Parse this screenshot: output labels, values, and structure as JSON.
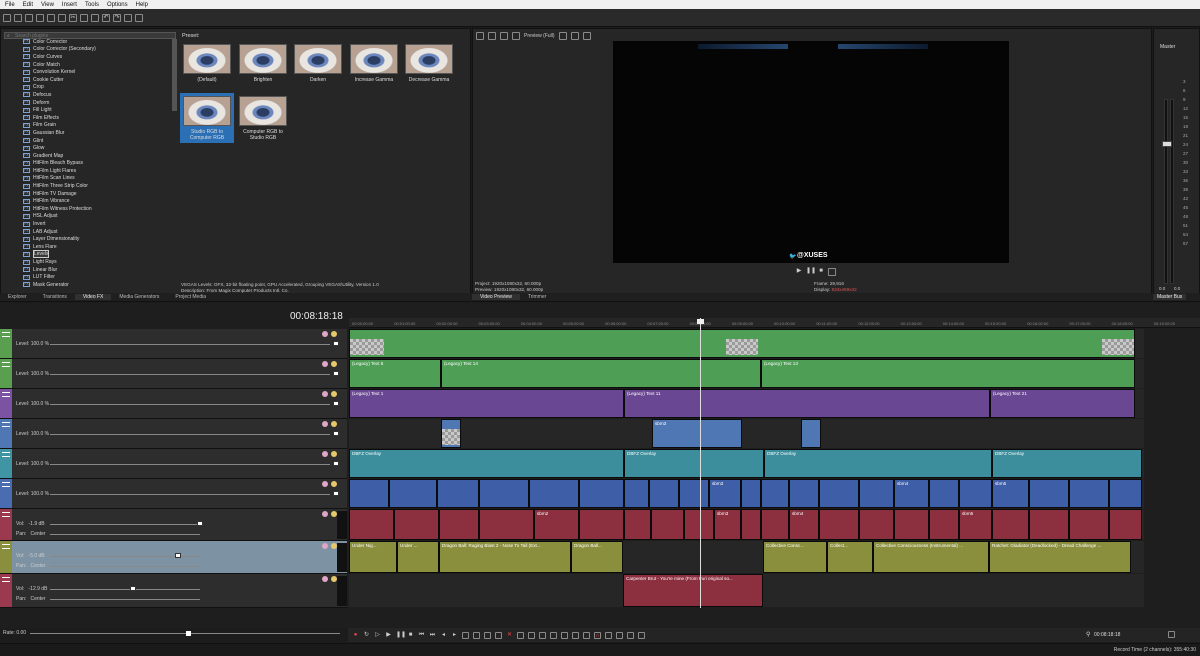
{
  "menu": [
    "File",
    "Edit",
    "View",
    "Insert",
    "Tools",
    "Options",
    "Help"
  ],
  "explorer": {
    "search_placeholder": "Search plugins",
    "preset_label": "Preset:",
    "plugins": [
      "Color Corrector",
      "Color Corrector (Secondary)",
      "Color Curves",
      "Color Match",
      "Convolution Kernel",
      "Cookie Cutter",
      "Crop",
      "Defocus",
      "Deform",
      "Fill Light",
      "Film Effects",
      "Film Grain",
      "Gaussian Blur",
      "Glint",
      "Glow",
      "Gradient Map",
      "HitFilm Bleach Bypass",
      "HitFilm Light Flares",
      "HitFilm Scan Lines",
      "HitFilm Three Strip Color",
      "HitFilm TV Damage",
      "HitFilm Vibrance",
      "HitFilm Witness Protection",
      "HSL Adjust",
      "Invert",
      "LAB Adjust",
      "Layer Dimensionality",
      "Lens Flare",
      "Levels",
      "Light Rays",
      "Linear Blur",
      "LUT Filter",
      "Mask Generator"
    ],
    "selected_plugin": "Levels",
    "presets": [
      {
        "name": "(Default)"
      },
      {
        "name": "Brighten"
      },
      {
        "name": "Darken"
      },
      {
        "name": "Increase Gamma"
      },
      {
        "name": "Decrease Gamma"
      },
      {
        "name": "Studio RGB to Computer RGB",
        "selected": true
      },
      {
        "name": "Computer RGB to Studio RGB"
      }
    ],
    "info_line1": "VEGAS Levels: OFX, 32-bit floating point, GPU Accelerated, Grouping VEGAS\\Utility, Version 1.0",
    "info_line2": "Description: From Magix Computer Products Intl. Co.",
    "tabs": [
      "Explorer",
      "Transitions",
      "Video FX",
      "Media Generators",
      "Project Media"
    ],
    "active_tab": "Video FX"
  },
  "preview": {
    "toolbar_label": "Preview (Full)",
    "overlay_text": "@XUSES",
    "project": "Project:",
    "project_val": "1920x1080x32, 60.000p",
    "preview": "Preview:",
    "preview_val": "1920x1080x32, 60.000p",
    "frame": "Frame:",
    "frame_val": "29,916",
    "display": "Display:",
    "display_val": "834x469x32",
    "tabs": [
      "Video Preview",
      "Trimmer"
    ]
  },
  "master": {
    "label": "Master",
    "scale": [
      "3",
      "6",
      "9",
      "12",
      "15",
      "18",
      "21",
      "24",
      "27",
      "30",
      "33",
      "36",
      "39",
      "42",
      "45",
      "48",
      "51",
      "54",
      "57"
    ],
    "bottom_left": "0.0",
    "bottom_right": "0.0",
    "tab": "Master Bus"
  },
  "timeline": {
    "timecode": "00:08:18:18",
    "ruler": [
      "00:00:00:00",
      "00:01:00:00",
      "00:02:00:00",
      "00:03:00:00",
      "00:04:00:00",
      "00:05:00:00",
      "00:06:00:00",
      "00:07:00:00",
      "00:08:00:00",
      "00:09:00:00",
      "00:10:00:00",
      "00:11:00:00",
      "00:12:00:00",
      "00:13:00:00",
      "00:14:00:00",
      "00:15:00:00",
      "00:16:00:00",
      "00:17:00:00",
      "00:18:00:00",
      "00:19:00:00"
    ],
    "video_level": "Level: 100.0 %",
    "audio": [
      {
        "vol": "Vol:",
        "vol_val": "-1.9 dB",
        "pan": "Pan:",
        "pan_val": "Center"
      },
      {
        "vol": "Vol:",
        "vol_val": "-5.0 dB",
        "pan": "Pan:",
        "pan_val": "Center"
      },
      {
        "vol": "Vol:",
        "vol_val": "-12.9 dB",
        "pan": "Pan:",
        "pan_val": "Center"
      }
    ],
    "clips": {
      "t2": [
        "(Legacy) Text 6",
        "(Legacy) Text 14",
        "(Legacy) Text 13"
      ],
      "t3": [
        "(Legacy) Text 1",
        "(Legacy) Text 11",
        "(Legacy) Text 21"
      ],
      "t4": [
        "sbm3"
      ],
      "t5": [
        "DBFZ Overlay",
        "DBFZ Overlay",
        "DBFZ Overlay",
        "DBFZ Overlay"
      ],
      "t6": [
        "sbm3",
        "sbm4",
        "sbm5"
      ],
      "t7": [
        "sbm2",
        "sbm3",
        "sbm4",
        "sbm5"
      ],
      "t8": [
        "Under Nig...",
        "Under ...",
        "Dragon Ball: Raging Blast 2 - Nose To Tail (Ext...",
        "Dragon Ball...",
        "Collective Consc...",
        "Collect...",
        "Collective Consciousness (Instrumental) ...",
        "Ratchet: Gladiator (Deadlocked) - Dread Challenge ..."
      ],
      "t9": [
        "Carpenter Brut - You're mine (From Furi original so..."
      ]
    },
    "rate": "Rate: 0.00",
    "transport_time": "00:08:18:18",
    "record_time": "Record Time (2 channels): 355:40:30"
  }
}
